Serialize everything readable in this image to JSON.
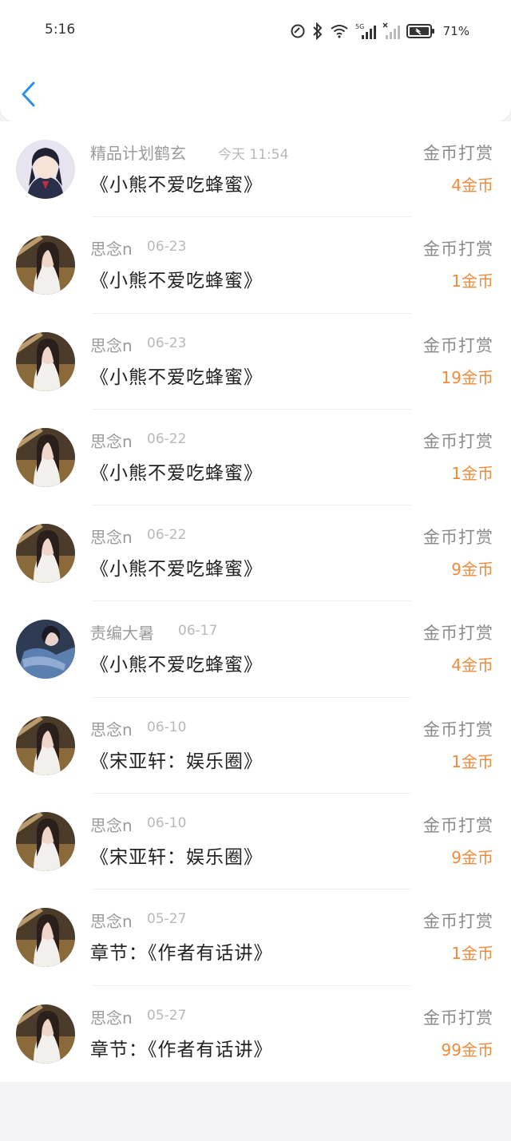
{
  "status_bar": {
    "time": "5:16",
    "battery": "71%",
    "network": "5G"
  },
  "header": {
    "back_icon": "chevron-left-icon",
    "accent_color": "#2f8fe8"
  },
  "colors": {
    "amount": "#f08a3c",
    "name": "#9a9a9a",
    "title": "#222222"
  },
  "rewards": [
    {
      "name": "精品计划鹤玄",
      "date": "今天 11:54",
      "title": "《小熊不爱吃蜂蜜》",
      "type": "金币打赏",
      "amount": "4金币",
      "avatar": "anime"
    },
    {
      "name": "思念n",
      "date": "06-23",
      "title": "《小熊不爱吃蜂蜜》",
      "type": "金币打赏",
      "amount": "1金币",
      "avatar": "photo"
    },
    {
      "name": "思念n",
      "date": "06-23",
      "title": "《小熊不爱吃蜂蜜》",
      "type": "金币打赏",
      "amount": "19金币",
      "avatar": "photo"
    },
    {
      "name": "思念n",
      "date": "06-22",
      "title": "《小熊不爱吃蜂蜜》",
      "type": "金币打赏",
      "amount": "1金币",
      "avatar": "photo"
    },
    {
      "name": "思念n",
      "date": "06-22",
      "title": "《小熊不爱吃蜂蜜》",
      "type": "金币打赏",
      "amount": "9金币",
      "avatar": "photo"
    },
    {
      "name": "责编大暑",
      "date": "06-17",
      "title": "《小熊不爱吃蜂蜜》",
      "type": "金币打赏",
      "amount": "4金币",
      "avatar": "blue"
    },
    {
      "name": "思念n",
      "date": "06-10",
      "title": "《宋亚轩：娱乐圈》",
      "type": "金币打赏",
      "amount": "1金币",
      "avatar": "photo"
    },
    {
      "name": "思念n",
      "date": "06-10",
      "title": "《宋亚轩：娱乐圈》",
      "type": "金币打赏",
      "amount": "9金币",
      "avatar": "photo"
    },
    {
      "name": "思念n",
      "date": "05-27",
      "title": "章节：《作者有话讲》",
      "type": "金币打赏",
      "amount": "1金币",
      "avatar": "photo"
    },
    {
      "name": "思念n",
      "date": "05-27",
      "title": "章节：《作者有话讲》",
      "type": "金币打赏",
      "amount": "99金币",
      "avatar": "photo"
    }
  ]
}
